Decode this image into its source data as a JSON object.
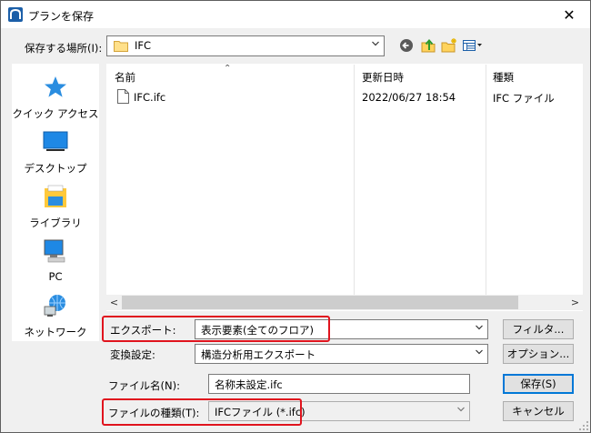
{
  "window": {
    "title": "プランを保存",
    "close_glyph": "✕"
  },
  "location": {
    "label": "保存する場所(I):",
    "value": "IFC"
  },
  "toolbar": {
    "back_icon": "back-icon",
    "up_icon": "up-folder-icon",
    "new_folder_icon": "new-folder-icon",
    "views_icon": "view-menu-icon"
  },
  "places": [
    {
      "label": "クイック アクセス",
      "icon": "star-icon"
    },
    {
      "label": "デスクトップ",
      "icon": "desktop-icon"
    },
    {
      "label": "ライブラリ",
      "icon": "library-icon"
    },
    {
      "label": "PC",
      "icon": "pc-icon"
    },
    {
      "label": "ネットワーク",
      "icon": "network-icon"
    }
  ],
  "filelist": {
    "columns": {
      "name": "名前",
      "modified": "更新日時",
      "type": "種類"
    },
    "rows": [
      {
        "name": "IFC.ifc",
        "modified": "2022/06/27 18:54",
        "type": "IFC ファイル"
      }
    ]
  },
  "export": {
    "label": "エクスポート:",
    "value": "表示要素(全てのフロア)"
  },
  "conversion": {
    "label": "変換設定:",
    "value": "構造分析用エクスポート"
  },
  "filename": {
    "label": "ファイル名(N):",
    "value": "名称未設定.ifc"
  },
  "filetype": {
    "label": "ファイルの種類(T):",
    "value": "IFCファイル (*.ifc)"
  },
  "buttons": {
    "filter": "フィルタ...",
    "options": "オプション...",
    "save": "保存(S)",
    "cancel": "キャンセル"
  },
  "colors": {
    "highlight": "#e0141e",
    "accent": "#0078d7"
  }
}
